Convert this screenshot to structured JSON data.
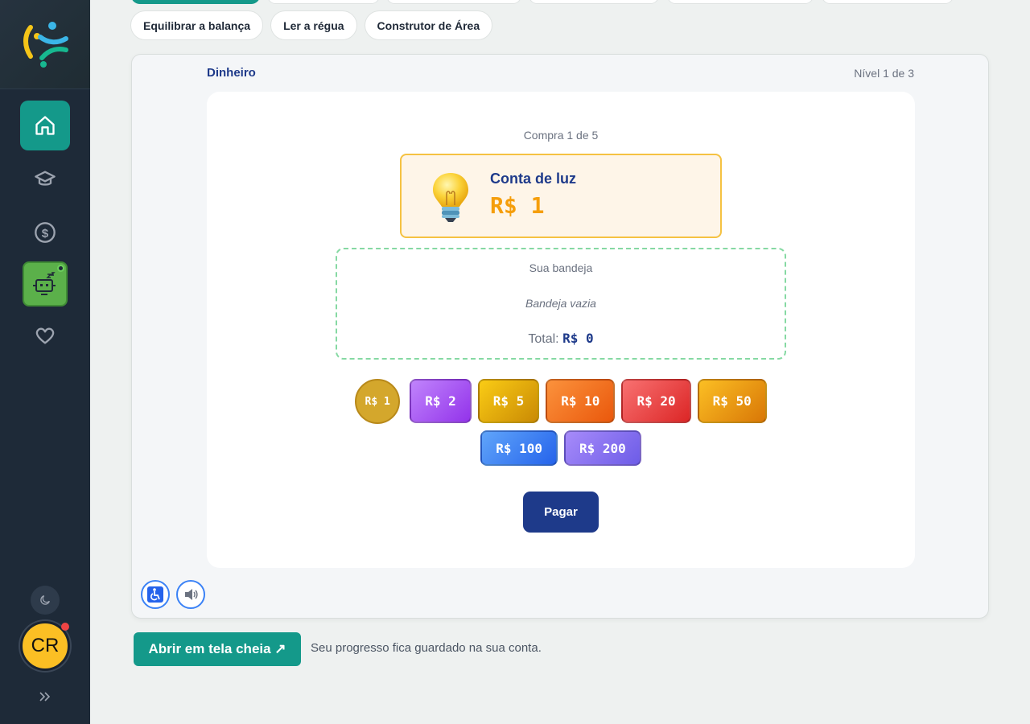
{
  "sidebar": {
    "nav": [
      {
        "icon": "home-icon"
      },
      {
        "icon": "graduation-cap-icon"
      },
      {
        "icon": "dollar-icon"
      },
      {
        "icon": "robot-icon"
      },
      {
        "icon": "heart-icon"
      }
    ],
    "avatar_initials": "CR",
    "theme_toggle_icon": "moon-icon",
    "expand_icon": "chevrons-right-icon"
  },
  "tabs": {
    "chips": [
      "Equilibrar a balança",
      "Ler a régua",
      "Construtor de Área"
    ]
  },
  "game": {
    "title": "Dinheiro",
    "level": "Nível 1 de 3",
    "purchase_counter": "Compra 1 de 5",
    "bill": {
      "icon": "lightbulb-icon",
      "name": "Conta de luz",
      "price": "R$ 1"
    },
    "tray": {
      "title": "Sua bandeja",
      "empty_text": "Bandeja vazia",
      "total_label": "Total:",
      "total_value": "R$ 0"
    },
    "money": [
      {
        "label": "R$ 1",
        "kind": "coin",
        "color": "#d4a72c"
      },
      {
        "label": "R$ 2",
        "kind": "note",
        "color": "#a855f7"
      },
      {
        "label": "R$ 5",
        "kind": "note",
        "color": "#eab308"
      },
      {
        "label": "R$ 10",
        "kind": "note",
        "color": "#f97316"
      },
      {
        "label": "R$ 20",
        "kind": "note",
        "color": "#ef4444"
      },
      {
        "label": "R$ 50",
        "kind": "note",
        "color": "#f59e0b"
      },
      {
        "label": "R$ 100",
        "kind": "note",
        "color": "#3b82f6"
      },
      {
        "label": "R$ 200",
        "kind": "note",
        "color": "#8b5cf6"
      }
    ],
    "pay_label": "Pagar",
    "accessibility_icon": "accessibility-icon",
    "sound_icon": "speaker-icon"
  },
  "footer": {
    "fullscreen_label": "Abrir em tela cheia ↗",
    "progress_note": "Seu progresso fica guardado na sua conta."
  },
  "colors": {
    "accent": "#14998a",
    "navy": "#1e3a8a",
    "sidebar_bg": "#1e2a38"
  }
}
